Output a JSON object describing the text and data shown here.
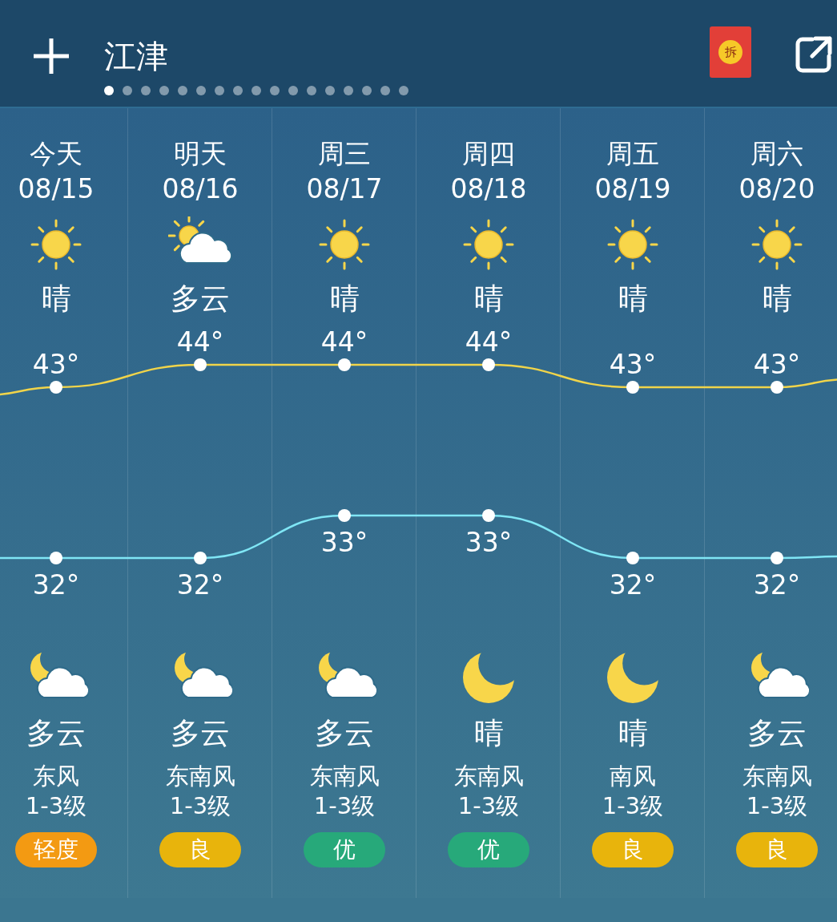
{
  "header": {
    "title": "江津",
    "envelope_label": "拆"
  },
  "page_dots": [
    {
      "selected": true
    },
    {
      "selected": false
    },
    {
      "selected": false
    },
    {
      "selected": false
    },
    {
      "selected": false
    },
    {
      "selected": false
    },
    {
      "selected": false
    },
    {
      "selected": false
    },
    {
      "selected": false
    },
    {
      "selected": false
    },
    {
      "selected": false
    },
    {
      "selected": false
    },
    {
      "selected": false
    },
    {
      "selected": false
    },
    {
      "selected": false
    },
    {
      "selected": false
    },
    {
      "selected": false
    }
  ],
  "days": [
    {
      "weekday": "今天",
      "date": "08/15",
      "day": {
        "kind": "sunny",
        "condition": "晴"
      },
      "high": "43°",
      "low": "32°",
      "night": {
        "kind": "moon-cloud",
        "condition": "多云"
      },
      "wind": "东风",
      "wind_level": "1-3级",
      "aqi": {
        "label": "轻度",
        "color": "#f39a12"
      }
    },
    {
      "weekday": "明天",
      "date": "08/16",
      "day": {
        "kind": "sun-cloud",
        "condition": "多云"
      },
      "high": "44°",
      "low": "32°",
      "night": {
        "kind": "moon-cloud",
        "condition": "多云"
      },
      "wind": "东南风",
      "wind_level": "1-3级",
      "aqi": {
        "label": "良",
        "color": "#e8b40c"
      }
    },
    {
      "weekday": "周三",
      "date": "08/17",
      "day": {
        "kind": "sunny",
        "condition": "晴"
      },
      "high": "44°",
      "low": "33°",
      "night": {
        "kind": "moon-cloud",
        "condition": "多云"
      },
      "wind": "东南风",
      "wind_level": "1-3级",
      "aqi": {
        "label": "优",
        "color": "#27a97a"
      }
    },
    {
      "weekday": "周四",
      "date": "08/18",
      "day": {
        "kind": "sunny",
        "condition": "晴"
      },
      "high": "44°",
      "low": "33°",
      "night": {
        "kind": "moon",
        "condition": "晴"
      },
      "wind": "东南风",
      "wind_level": "1-3级",
      "aqi": {
        "label": "优",
        "color": "#27a97a"
      }
    },
    {
      "weekday": "周五",
      "date": "08/19",
      "day": {
        "kind": "sunny",
        "condition": "晴"
      },
      "high": "43°",
      "low": "32°",
      "night": {
        "kind": "moon",
        "condition": "晴"
      },
      "wind": "南风",
      "wind_level": "1-3级",
      "aqi": {
        "label": "良",
        "color": "#e8b40c"
      }
    },
    {
      "weekday": "周六",
      "date": "08/20",
      "day": {
        "kind": "sunny",
        "condition": "晴"
      },
      "high": "43°",
      "low": "32°",
      "night": {
        "kind": "moon-cloud",
        "condition": "多云"
      },
      "wind": "东南风",
      "wind_level": "1-3级",
      "aqi": {
        "label": "良",
        "color": "#e8b40c"
      }
    }
  ]
}
